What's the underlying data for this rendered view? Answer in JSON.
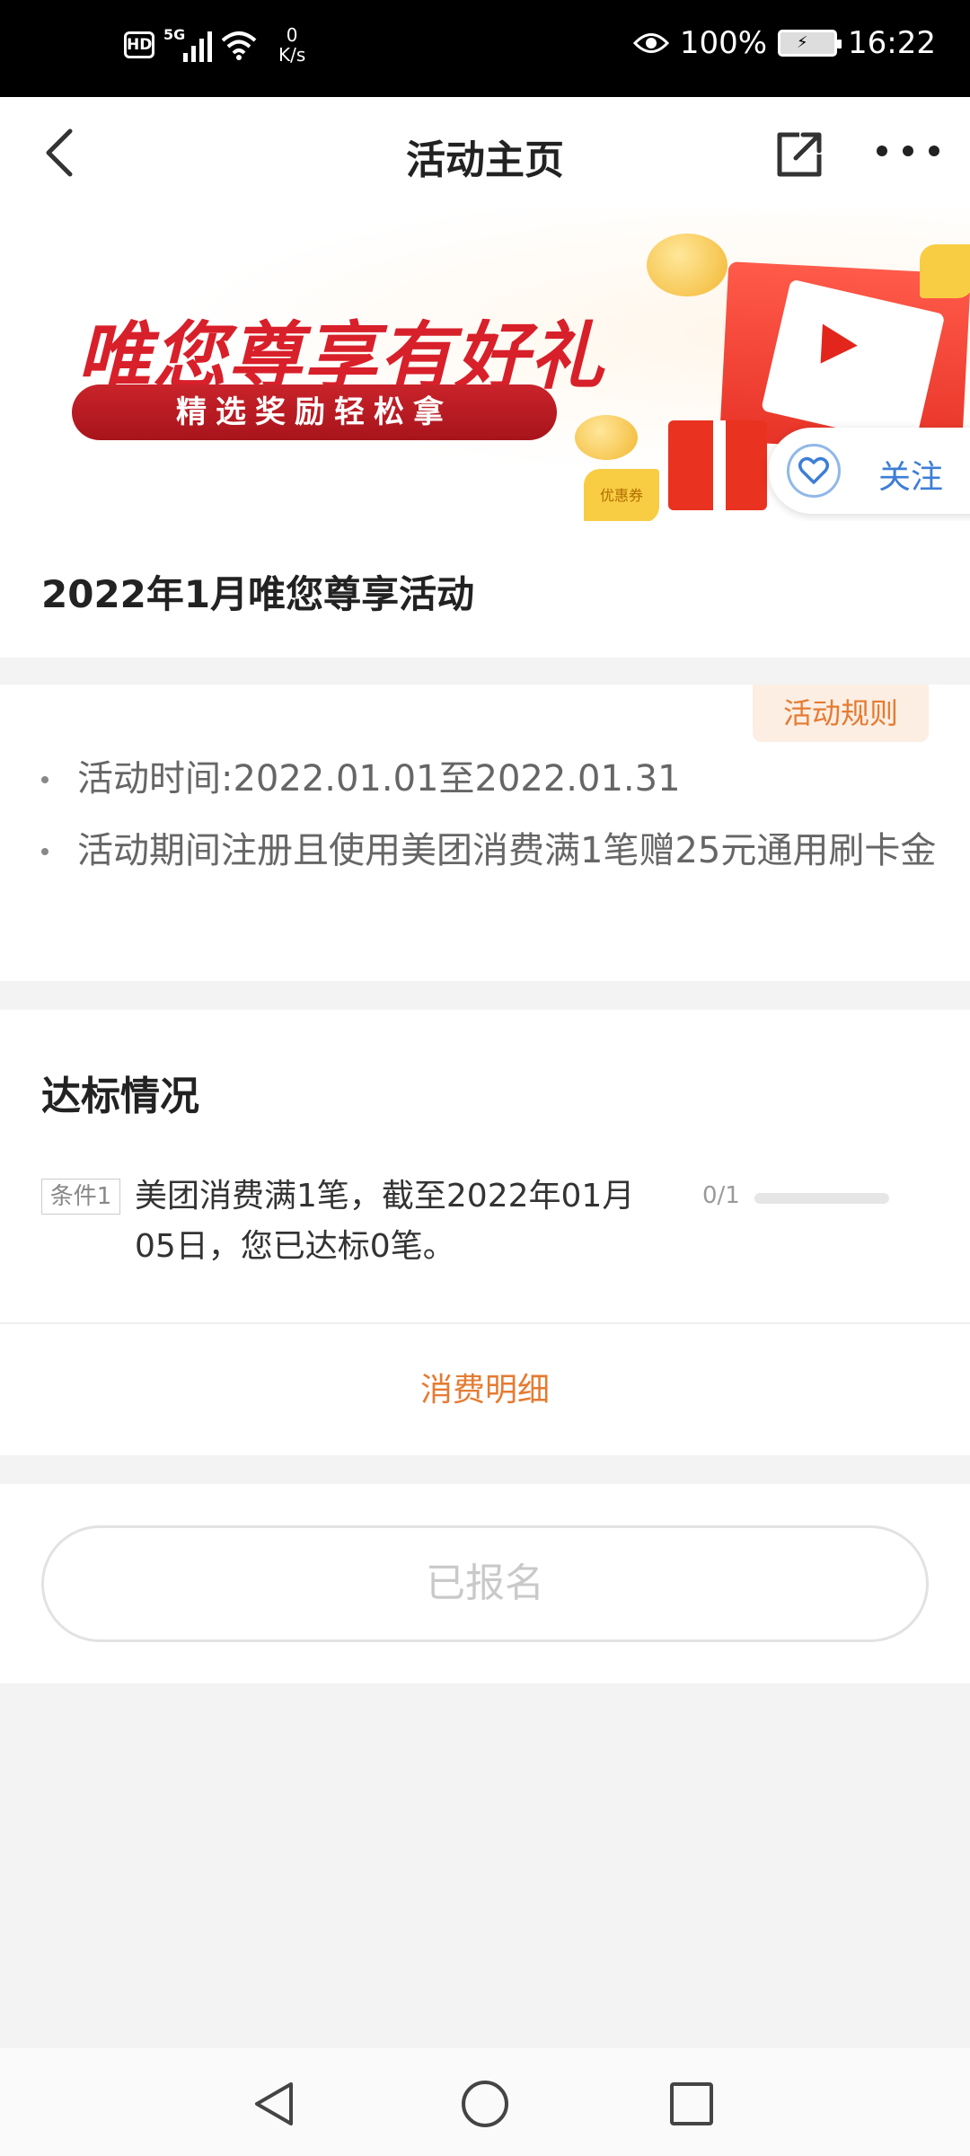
{
  "status_bar": {
    "hd": "HD",
    "network": "5G",
    "speed_value": "0",
    "speed_unit": "K/s",
    "battery": "100%",
    "time": "16:22"
  },
  "header": {
    "title": "活动主页"
  },
  "banner": {
    "title": "唯您尊享有好礼",
    "subtitle": "精选奖励轻松拿",
    "coupon_text": "优惠券",
    "follow_label": "关注"
  },
  "activity": {
    "title": "2022年1月唯您尊享活动"
  },
  "rules": {
    "tag": "活动规则",
    "items": [
      "活动时间:2022.01.01至2022.01.31",
      "活动期间注册且使用美团消费满1笔赠25元通用刷卡金"
    ]
  },
  "progress": {
    "heading": "达标情况",
    "conditions": [
      {
        "tag": "条件1",
        "text": "美团消费满1笔，截至2022年01月05日，您已达标0笔。",
        "count": "0/1",
        "fraction": 0
      }
    ],
    "detail_link": "消费明细"
  },
  "action": {
    "register_label": "已报名"
  },
  "colors": {
    "accent": "#e57b32",
    "banner_red": "#d8202a",
    "link_blue": "#3d7ed6"
  }
}
